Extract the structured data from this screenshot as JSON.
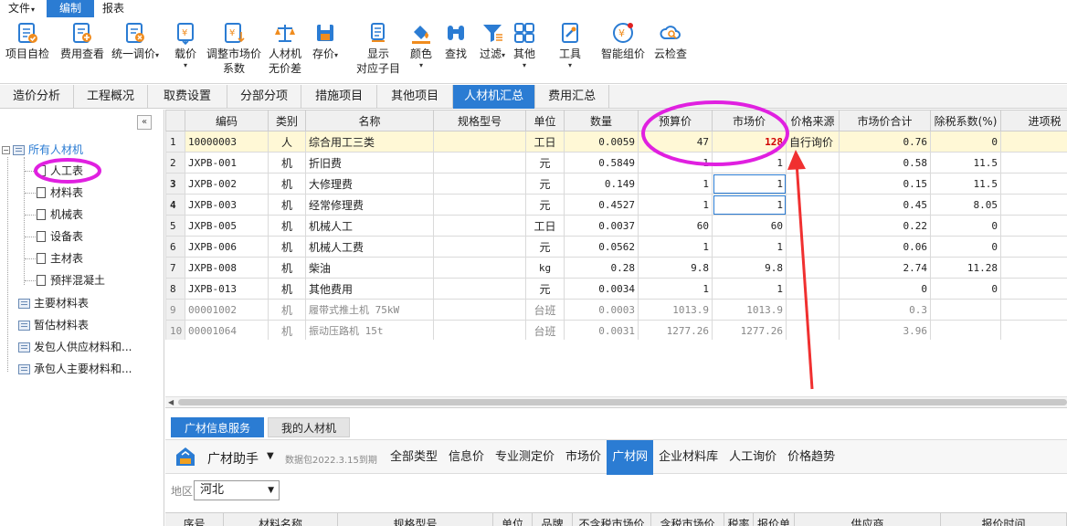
{
  "menu": {
    "file": "文件",
    "edit": "编制",
    "report": "报表"
  },
  "ribbon": {
    "items": [
      {
        "id": "check",
        "label": "项目自检",
        "label2": ""
      },
      {
        "id": "fee",
        "label": "费用查看",
        "label2": ""
      },
      {
        "id": "adjust",
        "label": "统一调价",
        "label2": ""
      },
      {
        "id": "price",
        "label": "载价",
        "label2": ""
      },
      {
        "id": "market",
        "label": "调整市场价",
        "label2": "系数"
      },
      {
        "id": "nodiff",
        "label": "人材机",
        "label2": "无价差"
      },
      {
        "id": "store",
        "label": "存价",
        "label2": ""
      },
      {
        "id": "show",
        "label": "显示",
        "label2": "对应子目"
      },
      {
        "id": "color",
        "label": "颜色",
        "label2": ""
      },
      {
        "id": "find",
        "label": "查找",
        "label2": ""
      },
      {
        "id": "filter",
        "label": "过滤",
        "label2": ""
      },
      {
        "id": "other",
        "label": "其他",
        "label2": ""
      },
      {
        "id": "tools",
        "label": "工具",
        "label2": ""
      },
      {
        "id": "smart",
        "label": "智能组价",
        "label2": ""
      },
      {
        "id": "cloud",
        "label": "云检查",
        "label2": ""
      }
    ]
  },
  "tabs": [
    "造价分析",
    "工程概况",
    "取费设置",
    "分部分项",
    "措施项目",
    "其他项目",
    "人材机汇总",
    "费用汇总"
  ],
  "tree": {
    "root": "所有人材机",
    "children": [
      "人工表",
      "材料表",
      "机械表",
      "设备表",
      "主材表",
      "预拌混凝土"
    ],
    "others": [
      "主要材料表",
      "暂估材料表",
      "发包人供应材料和...",
      "承包人主要材料和..."
    ]
  },
  "grid": {
    "headers": [
      "",
      "编码",
      "类别",
      "名称",
      "规格型号",
      "单位",
      "数量",
      "预算价",
      "市场价",
      "价格来源",
      "市场价合计",
      "除税系数(%)",
      "进项税"
    ],
    "rows": [
      [
        "1",
        "10000003",
        "人",
        "综合用工三类",
        "",
        "工日",
        "0.0059",
        "47",
        "128",
        "自行询价",
        "0.76",
        "0",
        ""
      ],
      [
        "2",
        "JXPB-001",
        "机",
        "折旧费",
        "",
        "元",
        "0.5849",
        "1",
        "1",
        "",
        "0.58",
        "11.5",
        ""
      ],
      [
        "3",
        "JXPB-002",
        "机",
        "大修理费",
        "",
        "元",
        "0.149",
        "1",
        "1",
        "",
        "0.15",
        "11.5",
        ""
      ],
      [
        "4",
        "JXPB-003",
        "机",
        "经常修理费",
        "",
        "元",
        "0.4527",
        "1",
        "1",
        "",
        "0.45",
        "8.05",
        ""
      ],
      [
        "5",
        "JXPB-005",
        "机",
        "机械人工",
        "",
        "工日",
        "0.0037",
        "60",
        "60",
        "",
        "0.22",
        "0",
        ""
      ],
      [
        "6",
        "JXPB-006",
        "机",
        "机械人工费",
        "",
        "元",
        "0.0562",
        "1",
        "1",
        "",
        "0.06",
        "0",
        ""
      ],
      [
        "7",
        "JXPB-008",
        "机",
        "柴油",
        "",
        "kg",
        "0.28",
        "9.8",
        "9.8",
        "",
        "2.74",
        "11.28",
        ""
      ],
      [
        "8",
        "JXPB-013",
        "机",
        "其他费用",
        "",
        "元",
        "0.0034",
        "1",
        "1",
        "",
        "0",
        "0",
        ""
      ],
      [
        "9",
        "00001002",
        "机",
        "履带式推土机 75kW",
        "",
        "台班",
        "0.0003",
        "1013.9",
        "1013.9",
        "",
        "0.3",
        "",
        ""
      ],
      [
        "10",
        "00001064",
        "机",
        "振动压路机 15t",
        "",
        "台班",
        "0.0031",
        "1277.26",
        "1277.26",
        "",
        "3.96",
        "",
        ""
      ]
    ]
  },
  "lower": {
    "tabs": [
      "广材信息服务",
      "我的人材机"
    ],
    "helper_title": "广材助手",
    "package": "数据包2022.3.15到期",
    "nav": [
      "全部类型",
      "信息价",
      "专业测定价",
      "市场价",
      "广材网",
      "企业材料库",
      "人工询价",
      "价格趋势"
    ],
    "region_label": "地区",
    "region_value": "河北",
    "columns": [
      "序号",
      "材料名称",
      "规格型号",
      "单位",
      "品牌",
      "不含税市场价",
      "含税市场价",
      "税率",
      "报价单",
      "供应商",
      "报价时间"
    ]
  },
  "colors": {
    "accent": "#2b7cd3",
    "highlight": "#e020e0",
    "arrow": "#f03030",
    "price_red": "#d00000"
  }
}
